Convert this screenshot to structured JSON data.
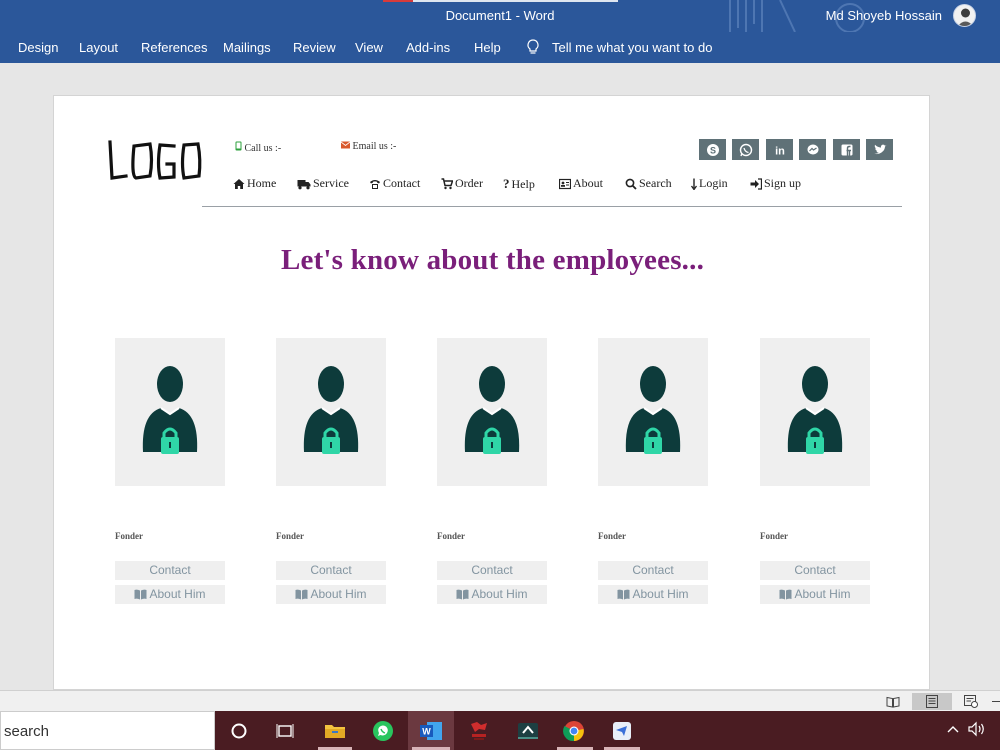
{
  "window": {
    "title": "Document1  -  Word",
    "user": "Md Shoyeb Hossain"
  },
  "ribbon": {
    "tabs": [
      "Design",
      "Layout",
      "References",
      "Mailings",
      "Review",
      "View",
      "Add-ins",
      "Help"
    ],
    "tell_me": "Tell me what you want to do"
  },
  "doc": {
    "logo_text": "LOGO",
    "call_label": "Call us :-",
    "email_label": "Email us :-",
    "social": [
      "skype-icon",
      "whatsapp-icon",
      "linkedin-icon",
      "messenger-icon",
      "facebook-icon",
      "twitter-icon"
    ],
    "nav": [
      {
        "label": "Home",
        "icon": "home-icon"
      },
      {
        "label": "Service",
        "icon": "truck-icon"
      },
      {
        "label": "Contact",
        "icon": "phone-icon"
      },
      {
        "label": "Order",
        "icon": "cart-icon"
      },
      {
        "label": "Help",
        "icon": "question-icon"
      },
      {
        "label": "About",
        "icon": "id-card-icon"
      },
      {
        "label": "Search",
        "icon": "search-icon"
      },
      {
        "label": "Login",
        "icon": "arrow-down-icon"
      },
      {
        "label": "Sign up",
        "icon": "sign-in-icon"
      }
    ],
    "headline": "Let's know about the employees...",
    "employees": [
      {
        "role": "Fonder",
        "contact": "Contact",
        "about": "About Him"
      },
      {
        "role": "Fonder",
        "contact": "Contact",
        "about": "About Him"
      },
      {
        "role": "Fonder",
        "contact": "Contact",
        "about": "About Him"
      },
      {
        "role": "Fonder",
        "contact": "Contact",
        "about": "About Him"
      },
      {
        "role": "Fonder",
        "contact": "Contact",
        "about": "About Him"
      }
    ]
  },
  "colors": {
    "word_blue": "#2b579a",
    "headline_purple": "#7a1f7a",
    "social_bg": "#5f7177",
    "person_dark": "#0d3b3b",
    "lock_green": "#2fd6a7",
    "taskbar": "#4a1c22"
  },
  "taskbar": {
    "search_text": "search",
    "apps": [
      "cortana-icon",
      "task-view-icon",
      "file-explorer-icon",
      "whatsapp-icon",
      "word-icon",
      "app-icon",
      "terminal-icon",
      "chrome-icon",
      "mail-icon"
    ]
  }
}
